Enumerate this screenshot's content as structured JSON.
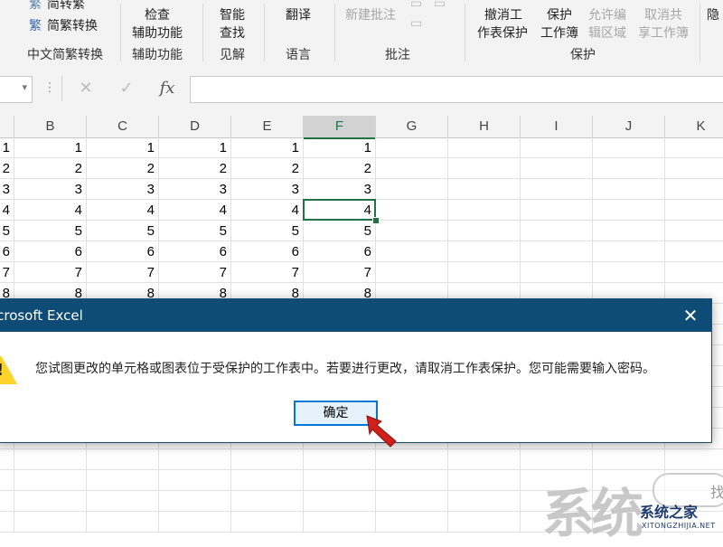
{
  "ribbon": {
    "items": {
      "convert_simplified": "简转繁",
      "trad_simplified_convert": "简繁转换",
      "check": "检查",
      "accessibility": "辅助功能",
      "smart": "智能",
      "lookup": "查找",
      "translate": "翻译",
      "new_comment": "新建批注",
      "unprotect_sheet_line1": "撤消工",
      "unprotect_sheet_line2": "作表保护",
      "protect_workbook_line1": "保护",
      "protect_workbook_line2": "工作簿",
      "allow_edit_line1": "允许编",
      "allow_edit_line2": "辑区域",
      "unshare_line1": "取消共",
      "unshare_line2": "享工作簿",
      "hide_partial": "隐"
    },
    "groups": {
      "chinese_convert": "中文简繁转换",
      "accessibility": "辅助功能",
      "insights": "见解",
      "language": "语言",
      "comments": "批注",
      "protect": "保护"
    }
  },
  "formula_bar": {
    "cancel_icon": "✕",
    "enter_icon": "✓",
    "fx": "fx",
    "value": ""
  },
  "sheet": {
    "columns": [
      "B",
      "C",
      "D",
      "E",
      "F",
      "G",
      "H",
      "I",
      "J",
      "K"
    ],
    "selected_column": "F",
    "rows": [
      [
        "1",
        "1",
        "1",
        "1",
        "1",
        "1"
      ],
      [
        "2",
        "2",
        "2",
        "2",
        "2",
        "2"
      ],
      [
        "3",
        "3",
        "3",
        "3",
        "3",
        "3"
      ],
      [
        "4",
        "4",
        "4",
        "4",
        "4",
        "4"
      ],
      [
        "5",
        "5",
        "5",
        "5",
        "5",
        "5"
      ],
      [
        "6",
        "6",
        "6",
        "6",
        "6",
        "6"
      ],
      [
        "7",
        "7",
        "7",
        "7",
        "7",
        "7"
      ],
      [
        "8",
        "8",
        "8",
        "8",
        "8",
        "8"
      ]
    ]
  },
  "dialog": {
    "title": "Microsoft Excel",
    "message": "您试图更改的单元格或图表位于受保护的工作表中。若要进行更改，请取消工作表保护。您可能需要输入密码。",
    "ok_label": "确定",
    "close_icon": "✕",
    "warning_mark": "!"
  },
  "watermark": {
    "big": "系统",
    "cn": "系统之家",
    "en": "XITONGZHIJIA.NET",
    "partial": "找"
  },
  "colors": {
    "accent_green": "#217346",
    "dialog_title_bg": "#0f4c75",
    "ok_border": "#0078d7",
    "warning": "#ffd42a",
    "pointer": "#d0201a"
  }
}
